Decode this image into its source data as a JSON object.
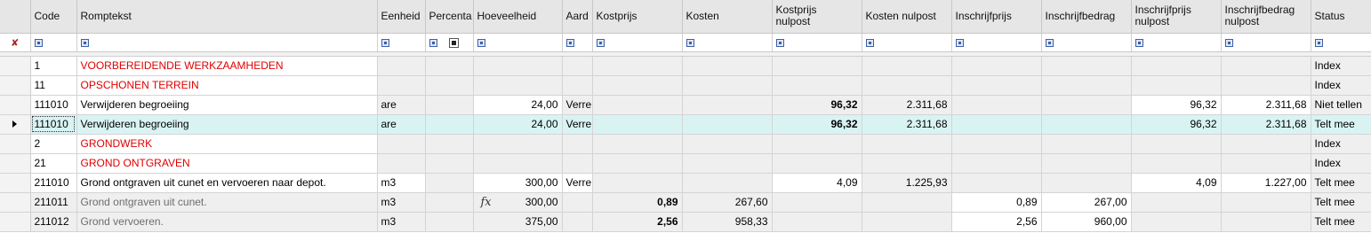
{
  "columns": {
    "code": "Code",
    "romptekst": "Romptekst",
    "eenheid": "Eenheid",
    "percentage": "Percenta",
    "hoeveelheid": "Hoeveelheid",
    "aard": "Aard",
    "kostprijs": "Kostprijs",
    "kosten": "Kosten",
    "kostprijs_nulpost": [
      "Kostprijs",
      "nulpost"
    ],
    "kosten_nulpost": "Kosten nulpost",
    "inschrijfprijs": "Inschrijfprijs",
    "inschrijfbedrag": "Inschrijfbedrag",
    "inschrijfprijs_nulpost": [
      "Inschrijfprijs",
      "nulpost"
    ],
    "inschrijfbedrag_nulpost": [
      "Inschrijfbedrag",
      "nulpost"
    ],
    "status": "Status"
  },
  "icons": {
    "filter_row_indicator": "pin-icon",
    "filter_cell": "filter-icon",
    "current_row": "row-pointer-arrow-icon",
    "formula": "fx-formula-icon"
  },
  "colors": {
    "group_text": "#e00000",
    "selected_row": "#d9f3f3",
    "header_bg": "#e6e6e6",
    "readonly_cell": "#efefef"
  },
  "rows": [
    {
      "code": "1",
      "text": "VOORBEREIDENDE WERKZAAMHEDEN",
      "eenheid": "",
      "hoeveelheid": "",
      "aard": "",
      "kostprijs": "",
      "kosten": "",
      "kp_nul": "",
      "k_nul": "",
      "ip": "",
      "ib": "",
      "ip_nul": "",
      "ib_nul": "",
      "status": "Index"
    },
    {
      "code": "11",
      "text": "OPSCHONEN TERREIN",
      "eenheid": "",
      "hoeveelheid": "",
      "aard": "",
      "kostprijs": "",
      "kosten": "",
      "kp_nul": "",
      "k_nul": "",
      "ip": "",
      "ib": "",
      "ip_nul": "",
      "ib_nul": "",
      "status": "Index"
    },
    {
      "code": "111010",
      "text": "Verwijderen begroeiing",
      "eenheid": "are",
      "hoeveelheid": "24,00",
      "aard": "Verre",
      "kostprijs": "",
      "kosten": "",
      "kp_nul": "96,32",
      "k_nul": "2.311,68",
      "ip": "",
      "ib": "",
      "ip_nul": "96,32",
      "ib_nul": "2.311,68",
      "status": "Niet tellen"
    },
    {
      "code": "111010",
      "text": "Verwijderen begroeiing",
      "eenheid": "are",
      "hoeveelheid": "24,00",
      "aard": "Verre",
      "kostprijs": "",
      "kosten": "",
      "kp_nul": "96,32",
      "k_nul": "2.311,68",
      "ip": "",
      "ib": "",
      "ip_nul": "96,32",
      "ib_nul": "2.311,68",
      "status": "Telt mee"
    },
    {
      "code": "2",
      "text": "GRONDWERK",
      "eenheid": "",
      "hoeveelheid": "",
      "aard": "",
      "kostprijs": "",
      "kosten": "",
      "kp_nul": "",
      "k_nul": "",
      "ip": "",
      "ib": "",
      "ip_nul": "",
      "ib_nul": "",
      "status": "Index"
    },
    {
      "code": "21",
      "text": "GROND ONTGRAVEN",
      "eenheid": "",
      "hoeveelheid": "",
      "aard": "",
      "kostprijs": "",
      "kosten": "",
      "kp_nul": "",
      "k_nul": "",
      "ip": "",
      "ib": "",
      "ip_nul": "",
      "ib_nul": "",
      "status": "Index"
    },
    {
      "code": "211010",
      "text": "Grond ontgraven uit cunet en vervoeren naar depot.",
      "eenheid": "m3",
      "hoeveelheid": "300,00",
      "aard": "Verre",
      "kostprijs": "",
      "kosten": "",
      "kp_nul": "4,09",
      "k_nul": "1.225,93",
      "ip": "",
      "ib": "",
      "ip_nul": "4,09",
      "ib_nul": "1.227,00",
      "status": "Telt mee"
    },
    {
      "code": "211011",
      "text": "Grond ontgraven uit cunet.",
      "eenheid": "m3",
      "hoeveelheid": "300,00",
      "aard": "",
      "kostprijs": "0,89",
      "kosten": "267,60",
      "kp_nul": "",
      "k_nul": "",
      "ip": "0,89",
      "ib": "267,00",
      "ip_nul": "",
      "ib_nul": "",
      "status": "Telt mee"
    },
    {
      "code": "211012",
      "text": "Grond vervoeren.",
      "eenheid": "m3",
      "hoeveelheid": "375,00",
      "aard": "",
      "kostprijs": "2,56",
      "kosten": "958,33",
      "kp_nul": "",
      "k_nul": "",
      "ip": "2,56",
      "ib": "960,00",
      "ip_nul": "",
      "ib_nul": "",
      "status": "Telt mee"
    }
  ]
}
